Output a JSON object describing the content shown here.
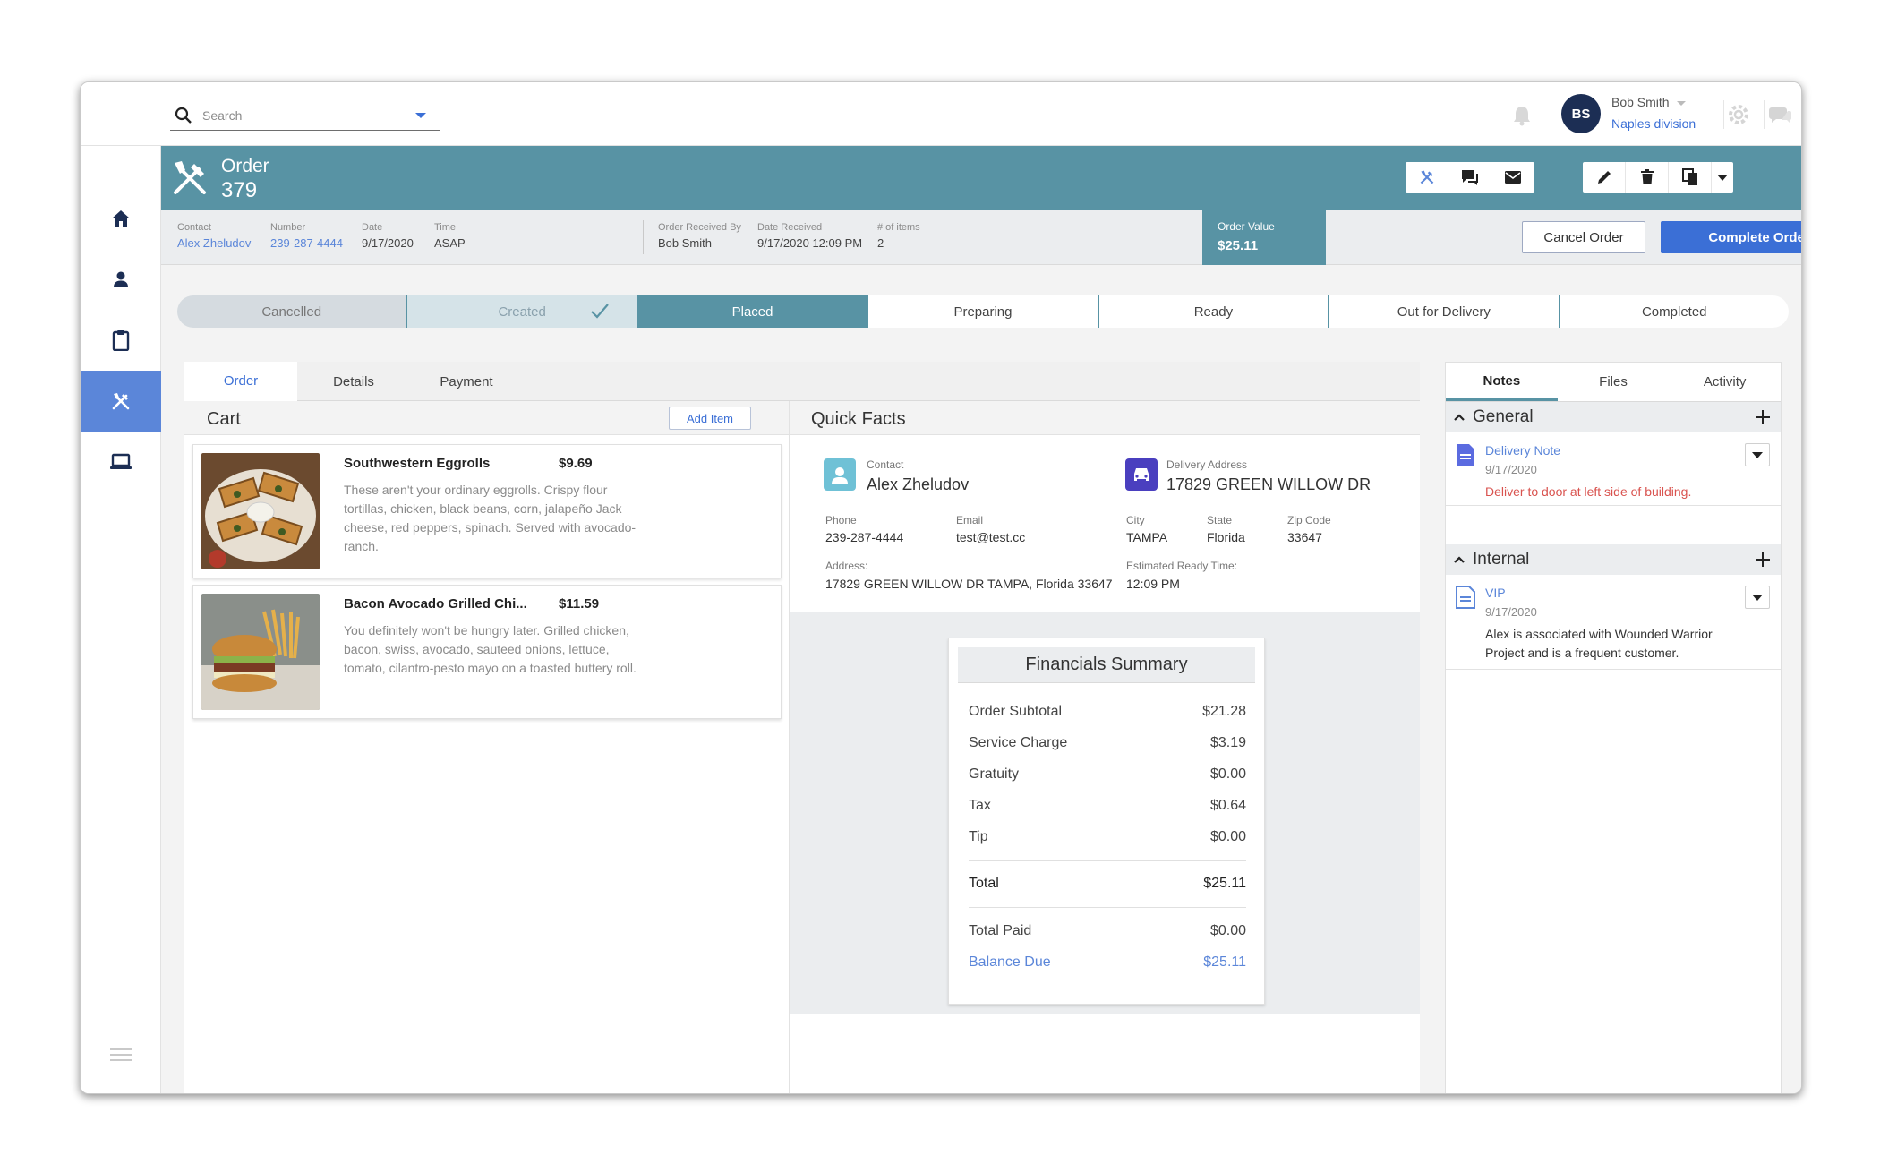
{
  "search": {
    "placeholder": "Search"
  },
  "user": {
    "initials": "BS",
    "name": "Bob Smith",
    "division": "Naples division"
  },
  "order": {
    "label": "Order",
    "number": "379"
  },
  "info": {
    "contact_label": "Contact",
    "contact": "Alex Zheludov",
    "number_label": "Number",
    "number": "239-287-4444",
    "date_label": "Date",
    "date": "9/17/2020",
    "time_label": "Time",
    "time": "ASAP",
    "received_by_label": "Order Received By",
    "received_by": "Bob Smith",
    "date_received_label": "Date Received",
    "date_received": "9/17/2020 12:09 PM",
    "items_label": "# of items",
    "items": "2",
    "order_value_label": "Order Value",
    "order_value": "$25.11"
  },
  "actions": {
    "cancel": "Cancel Order",
    "complete": "Complete Order"
  },
  "status_steps": [
    "Cancelled",
    "Created",
    "Placed",
    "Preparing",
    "Ready",
    "Out for Delivery",
    "Completed"
  ],
  "tabs": [
    "Order",
    "Details",
    "Payment"
  ],
  "cart": {
    "title": "Cart",
    "add_item": "Add Item",
    "items": [
      {
        "name": "Southwestern Eggrolls",
        "price": "$9.69",
        "description": "These aren't your ordinary eggrolls. Crispy flour tortillas, chicken, black beans, corn, jalapeño Jack cheese, red peppers, spinach. Served with avocado-ranch."
      },
      {
        "name": "Bacon Avocado Grilled Chi...",
        "price": "$11.59",
        "description": "You definitely won't be hungry later. Grilled chicken, bacon, swiss, avocado, sauteed onions, lettuce, tomato, cilantro-pesto mayo on a toasted buttery roll."
      }
    ]
  },
  "quick_facts": {
    "title": "Quick Facts",
    "contact_label": "Contact",
    "contact": "Alex Zheludov",
    "delivery_label": "Delivery Address",
    "delivery": "17829 GREEN WILLOW DR",
    "phone_label": "Phone",
    "phone": "239-287-4444",
    "email_label": "Email",
    "email": "test@test.cc",
    "city_label": "City",
    "city": "TAMPA",
    "state_label": "State",
    "state": "Florida",
    "zip_label": "Zip Code",
    "zip": "33647",
    "address_label": "Address:",
    "address": "17829 GREEN WILLOW DR TAMPA, Florida 33647",
    "ready_label": "Estimated Ready Time:",
    "ready": "12:09 PM"
  },
  "financials": {
    "title": "Financials Summary",
    "rows": [
      {
        "label": "Order Subtotal",
        "value": "$21.28"
      },
      {
        "label": "Service Charge",
        "value": "$3.19"
      },
      {
        "label": "Gratuity",
        "value": "$0.00"
      },
      {
        "label": "Tax",
        "value": "$0.64"
      },
      {
        "label": "Tip",
        "value": "$0.00"
      }
    ],
    "total_label": "Total",
    "total": "$25.11",
    "paid_label": "Total Paid",
    "paid": "$0.00",
    "balance_label": "Balance Due",
    "balance": "$25.11"
  },
  "right_tabs": [
    "Notes",
    "Files",
    "Activity"
  ],
  "notes": {
    "general": {
      "title": "General",
      "items": [
        {
          "title": "Delivery Note",
          "date": "9/17/2020",
          "text": "Deliver to door at left side of building."
        }
      ]
    },
    "internal": {
      "title": "Internal",
      "items": [
        {
          "title": "VIP",
          "date": "9/17/2020",
          "text": "Alex is associated with Wounded Warrior Project and is a frequent customer."
        }
      ]
    }
  },
  "colors": {
    "teal": "#5893a4",
    "blue": "#3b6fd6",
    "link": "#5b86d9",
    "note_red": "#d9534f",
    "avatar": "#1c2e54"
  },
  "icons": {
    "sidebar": [
      "home-icon",
      "person-icon",
      "clipboard-icon",
      "utensils-icon",
      "laptop-icon"
    ],
    "header_actions": [
      "utensils-icon",
      "chat-icon",
      "mail-icon",
      "edit-icon",
      "trash-icon",
      "copy-icon",
      "chevron-down-icon"
    ]
  }
}
